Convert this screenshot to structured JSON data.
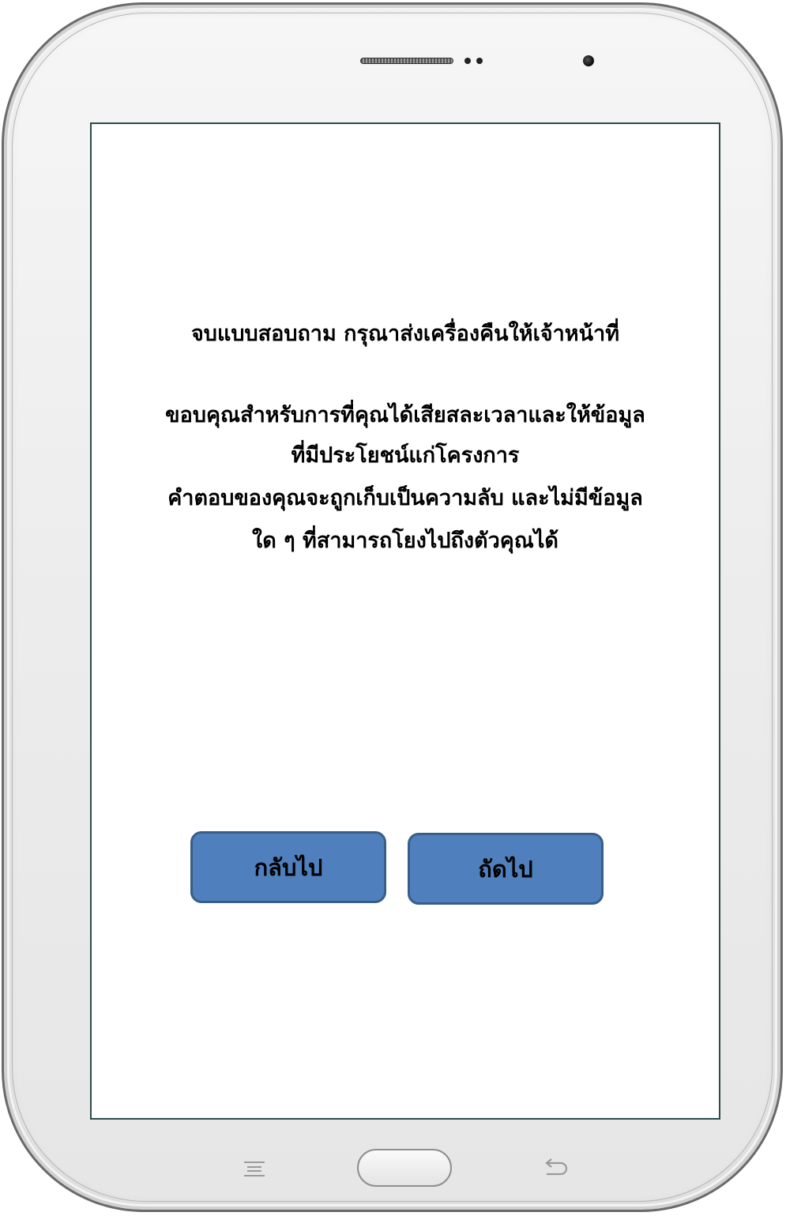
{
  "screen": {
    "messages": [
      "จบแบบสอบถาม กรุณาส่งเครื่องคืนให้เจ้าหน้าที่",
      "ขอบคุณสำหรับการที่คุณได้เสียสละเวลาและให้ข้อมูล",
      "ที่มีประโยชน์แก่โครงการ",
      "คำตอบของคุณจะถูกเก็บเป็นความลับ และไม่มีข้อมูล",
      "ใด ๆ ที่สามารถโยงไปถึงตัวคุณได้"
    ],
    "buttons": {
      "back_label": "กลับไป",
      "next_label": "ถัดไป"
    }
  },
  "hardware": {
    "menu_key_icon": "menu-icon",
    "home_key_icon": "home-button",
    "back_key_icon": "back-arrow-icon"
  },
  "colors": {
    "button_fill": "#4f80bd",
    "button_border": "#385d8a",
    "screen_border": "#2f4a4a"
  }
}
